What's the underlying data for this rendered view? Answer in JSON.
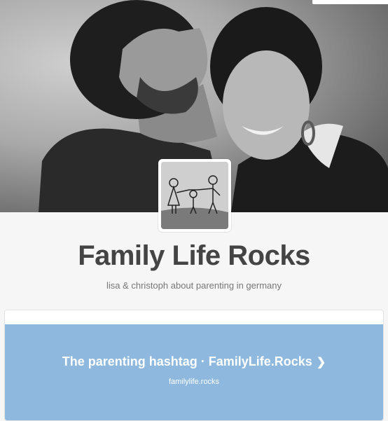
{
  "blog": {
    "title": "Family Life Rocks",
    "description": "lisa & christoph about parenting in germany"
  },
  "featured_link": {
    "title": "The parenting hashtag · FamilyLife.Rocks",
    "url": "familylife.rocks",
    "icon": "chevron-right-icon"
  },
  "header_image": {
    "description": "black and white portrait photo of a couple"
  },
  "avatar": {
    "description": "drawing of stick-figure family"
  },
  "colors": {
    "card_link_background": "#8eb8dd",
    "title_text": "#444444",
    "page_background": "#f6f6f6"
  }
}
